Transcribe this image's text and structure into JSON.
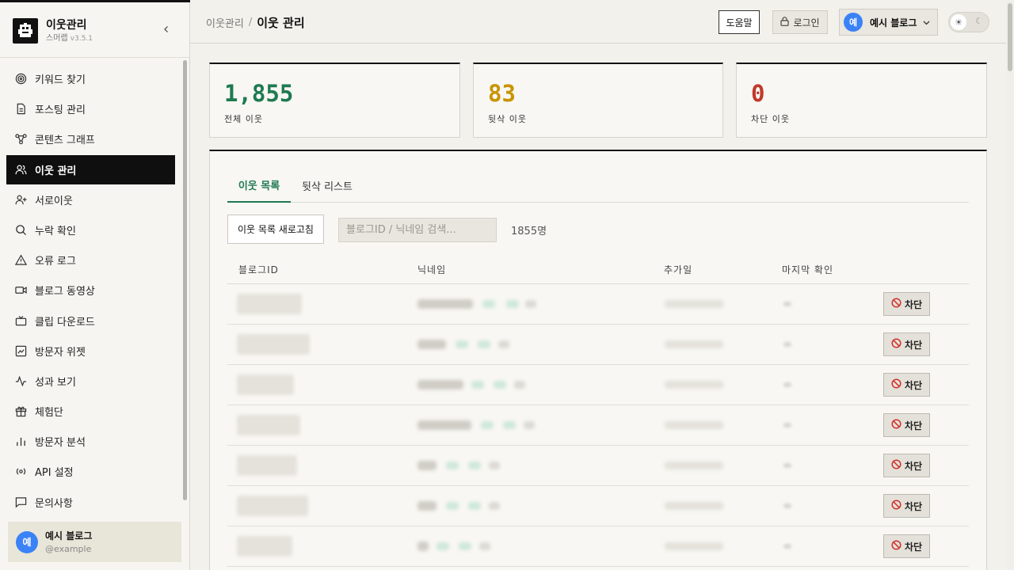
{
  "app": {
    "title": "이웃관리",
    "subtitle": "스머랩",
    "version": "v3.5.1"
  },
  "sidebar": {
    "items": [
      {
        "label": "키워드 찾기",
        "icon": "target-icon"
      },
      {
        "label": "포스팅 관리",
        "icon": "document-icon"
      },
      {
        "label": "콘텐츠 그래프",
        "icon": "graph-icon"
      },
      {
        "label": "이웃 관리",
        "icon": "users-icon",
        "active": true
      },
      {
        "label": "서로이웃",
        "icon": "user-plus-icon"
      },
      {
        "label": "누락 확인",
        "icon": "search-icon"
      },
      {
        "label": "오류 로그",
        "icon": "warning-icon"
      },
      {
        "label": "블로그 동영상",
        "icon": "video-icon"
      },
      {
        "label": "클립 다운로드",
        "icon": "tv-icon"
      },
      {
        "label": "방문자 위젯",
        "icon": "image-icon"
      },
      {
        "label": "성과 보기",
        "icon": "activity-icon"
      },
      {
        "label": "체험단",
        "icon": "gift-icon"
      },
      {
        "label": "방문자 분석",
        "icon": "bar-chart-icon"
      },
      {
        "label": "API 설정",
        "icon": "radio-icon"
      },
      {
        "label": "문의사항",
        "icon": "message-icon"
      }
    ],
    "user": {
      "avatar": "예",
      "name": "예시 블로그",
      "handle": "@example"
    }
  },
  "header": {
    "breadcrumb_parent": "이웃관리",
    "breadcrumb_sep": "/",
    "breadcrumb_current": "이웃 관리",
    "help_label": "도움말",
    "login_label": "로그인",
    "profile_avatar": "예",
    "profile_name": "예시 블로그"
  },
  "stats": [
    {
      "value": "1,855",
      "label": "전체 이웃",
      "color": "#1e7a4f"
    },
    {
      "value": "83",
      "label": "뒷삭 이웃",
      "color": "#c99400"
    },
    {
      "value": "0",
      "label": "차단 이웃",
      "color": "#c0392b"
    }
  ],
  "tabs": [
    "이웃 목록",
    "뒷삭 리스트"
  ],
  "toolbar": {
    "refresh_label": "이웃 목록 새로고침",
    "search_placeholder": "블로그ID / 닉네임 검색...",
    "count_label": "1855명"
  },
  "table": {
    "headers": [
      "블로그ID",
      "닉네임",
      "추가일",
      "마지막 확인"
    ],
    "block_label": "차단",
    "rows": 7
  },
  "colors": {
    "accent": "#1f7a52",
    "active_nav": "#0f0f0f",
    "avatar": "#3b82f6"
  }
}
